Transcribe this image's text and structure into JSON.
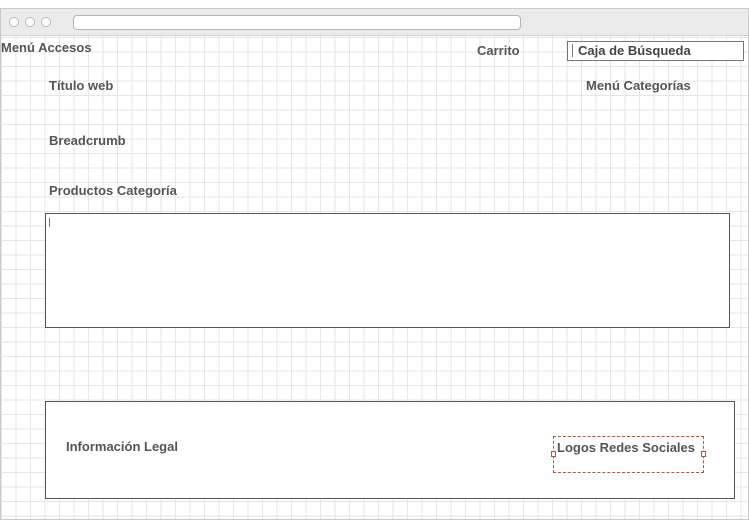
{
  "header": {
    "menu_accesos": "Menú Accesos",
    "carrito": "Carrito",
    "search_placeholder": "Caja de Búsqueda",
    "titulo_web": "Título web",
    "menu_categorias": "Menú Categorías"
  },
  "main": {
    "breadcrumb": "Breadcrumb",
    "productos_categoria": "Productos Categoría"
  },
  "footer": {
    "informacion_legal": "Información Legal",
    "logos_redes_sociales": "Logos Redes Sociales"
  },
  "colors": {
    "grid": "#e6e6e6",
    "label": "#555555",
    "border": "#555555",
    "selection": "#d34c2a"
  },
  "icons": [
    "window-control-icon"
  ]
}
